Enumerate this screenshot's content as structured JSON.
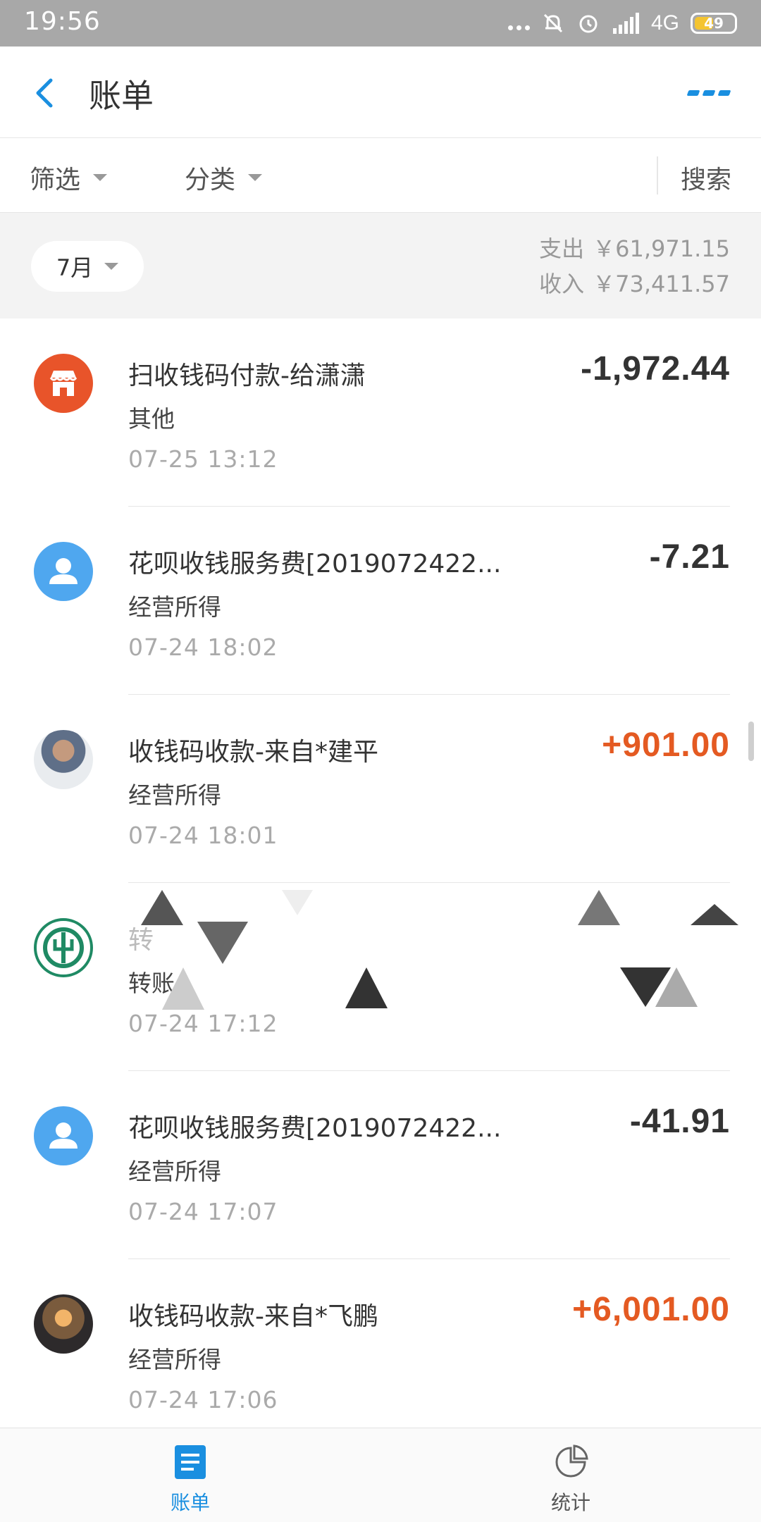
{
  "status_bar": {
    "time": "19:56",
    "network": "4G",
    "battery": "49",
    "battery_level": 0.49
  },
  "header": {
    "title": "账单",
    "back_icon": "chevron-left-icon",
    "more_icon": "more-icon",
    "accent_color": "#1a8fe0"
  },
  "filters": {
    "filter_label": "筛选",
    "category_label": "分类",
    "search_label": "搜索"
  },
  "summary": {
    "month": "7月",
    "expense_label": "支出",
    "expense_value": "￥61,971.15",
    "income_label": "收入",
    "income_value": "￥73,411.57"
  },
  "transactions": [
    {
      "icon": "store-icon",
      "title": "扫收钱码付款-给潇潇",
      "category": "其他",
      "time": "07-25  13:12",
      "amount": "-1,972.44",
      "type": "expense"
    },
    {
      "icon": "user-icon",
      "title": "花呗收钱服务费[2019072422...",
      "category": "经营所得",
      "time": "07-24  18:02",
      "amount": "-7.21",
      "type": "expense"
    },
    {
      "icon": "avatar-photo",
      "title": "收钱码收款-来自*建平",
      "category": "经营所得",
      "time": "07-24  18:01",
      "amount": "+901.00",
      "type": "income"
    },
    {
      "icon": "bank-icon",
      "title": "转",
      "category": "转账",
      "time": "07-24  17:12",
      "amount": "",
      "type": "redacted"
    },
    {
      "icon": "user-icon",
      "title": "花呗收钱服务费[2019072422...",
      "category": "经营所得",
      "time": "07-24  17:07",
      "amount": "-41.91",
      "type": "expense"
    },
    {
      "icon": "avatar-photo",
      "title": "收钱码收款-来自*飞鹏",
      "category": "经营所得",
      "time": "07-24  17:06",
      "amount": "+6,001.00",
      "type": "income"
    }
  ],
  "colors": {
    "income": "#e45a22",
    "expense": "#333333",
    "tab_active": "#1a8fe0"
  },
  "tabs": [
    {
      "label": "账单",
      "icon": "bill-icon",
      "active": true
    },
    {
      "label": "统计",
      "icon": "pie-chart-icon",
      "active": false
    }
  ]
}
